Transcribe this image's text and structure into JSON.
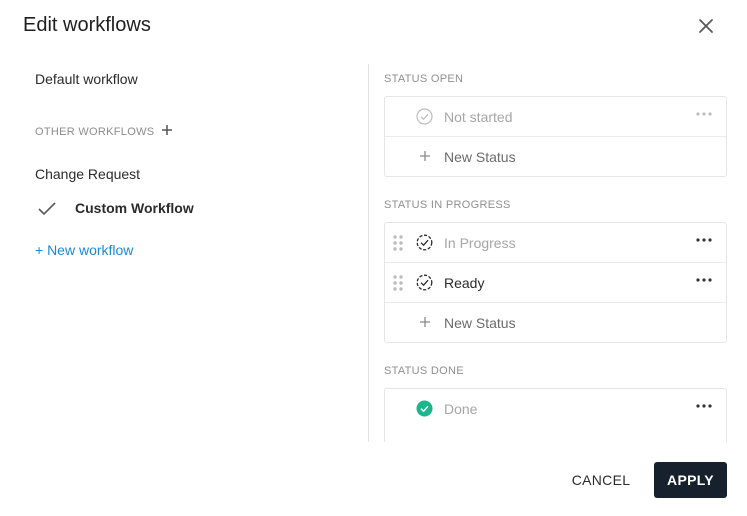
{
  "dialog": {
    "title": "Edit workflows"
  },
  "workflows": {
    "default": "Default workflow",
    "other_header": "OTHER WORKFLOWS",
    "items": [
      {
        "label": "Change Request",
        "selected": false
      },
      {
        "label": "Custom Workflow",
        "selected": true
      }
    ],
    "new_workflow": "+ New workflow"
  },
  "statuses": {
    "open": {
      "header": "STATUS OPEN",
      "items": [
        {
          "label": "Not started",
          "icon": "circle-check-icon"
        }
      ],
      "new_label": "New Status"
    },
    "in_progress": {
      "header": "STATUS IN PROGRESS",
      "items": [
        {
          "label": "In Progress",
          "icon": "dashed-circle-check-icon"
        },
        {
          "label": "Ready",
          "icon": "dashed-circle-check-icon"
        }
      ],
      "new_label": "New Status"
    },
    "done": {
      "header": "STATUS DONE",
      "items": [
        {
          "label": "Done",
          "icon": "filled-circle-check-icon"
        }
      ]
    }
  },
  "footer": {
    "cancel": "CANCEL",
    "apply": "APPLY"
  },
  "colors": {
    "accent_link": "#1a8ad4",
    "apply_bg": "#17212d",
    "done_green": "#1bb68c"
  }
}
